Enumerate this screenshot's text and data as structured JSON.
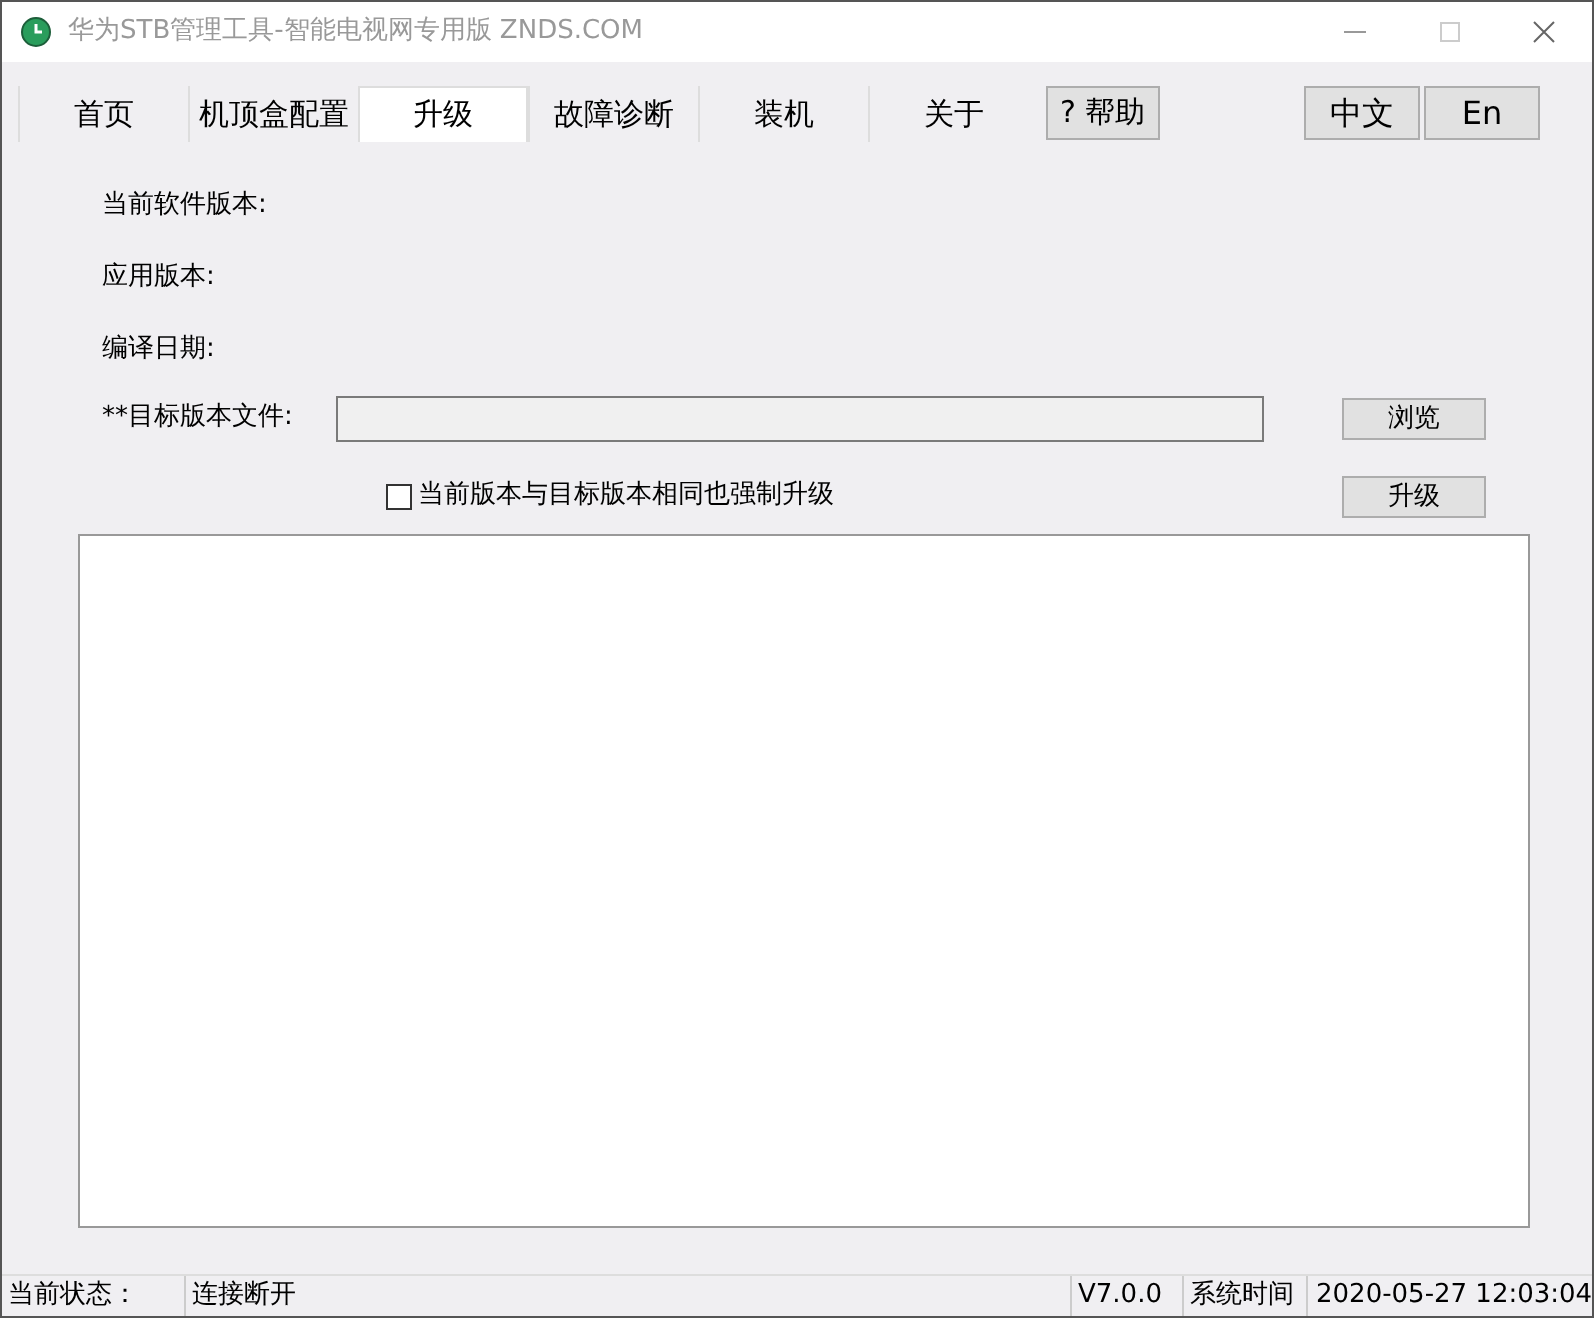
{
  "window": {
    "title": "华为STB管理工具-智能电视网专用版 ZNDS.COM"
  },
  "tabs": [
    {
      "label": "首页",
      "selected": false
    },
    {
      "label": "机顶盒配置",
      "selected": false
    },
    {
      "label": "升级",
      "selected": true
    },
    {
      "label": "故障诊断",
      "selected": false
    },
    {
      "label": "装机",
      "selected": false
    },
    {
      "label": "关于",
      "selected": false
    }
  ],
  "help_button": "? 帮助",
  "languages": [
    {
      "label": "中文",
      "selected": false
    },
    {
      "label": "En",
      "selected": false
    }
  ],
  "info_labels": [
    "当前软件版本:",
    "应用版本:",
    "编译日期:"
  ],
  "target_file": {
    "label": "**目标版本文件:",
    "browse": "浏览"
  },
  "force_upgrade": {
    "label": "当前版本与目标版本相同也强制升级",
    "checked": false
  },
  "upgrade_button": "升级",
  "status_bar": {
    "state_label": "当前状态：",
    "state": "连接断开",
    "version": "V7.0.0",
    "time_label": "系统时间",
    "time": "2020-05-27 12:03:04"
  }
}
